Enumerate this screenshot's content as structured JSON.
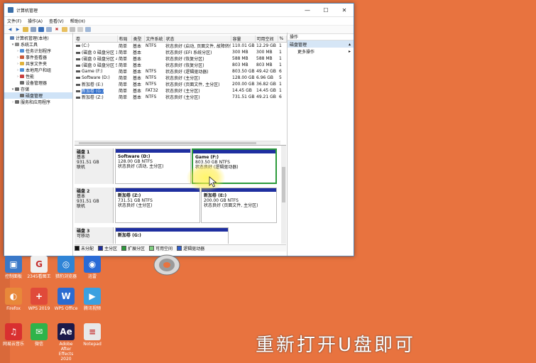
{
  "window": {
    "title": "计算机管理",
    "menu": [
      "文件(F)",
      "操作(A)",
      "查看(V)",
      "帮助(H)"
    ],
    "min_icon": "minimize-icon",
    "max_icon": "maximize-icon",
    "close_icon": "close-icon"
  },
  "tree": {
    "items": [
      {
        "label": "计算机管理(本地)",
        "indent": 0,
        "arrow": "",
        "color": "#5a7db0"
      },
      {
        "label": "系统工具",
        "indent": 1,
        "arrow": "▾",
        "color": "#8a8a8a"
      },
      {
        "label": "任务计划程序",
        "indent": 2,
        "arrow": "›",
        "color": "#4f8fd6"
      },
      {
        "label": "事件查看器",
        "indent": 2,
        "arrow": "›",
        "color": "#c85a3a"
      },
      {
        "label": "共享文件夹",
        "indent": 2,
        "arrow": "›",
        "color": "#e0b23c"
      },
      {
        "label": "本地用户和组",
        "indent": 2,
        "arrow": "›",
        "color": "#4f8fd6"
      },
      {
        "label": "性能",
        "indent": 2,
        "arrow": "›",
        "color": "#c84040"
      },
      {
        "label": "设备管理器",
        "indent": 2,
        "arrow": "",
        "color": "#6a6a6a"
      },
      {
        "label": "存储",
        "indent": 1,
        "arrow": "▾",
        "color": "#6a6a6a"
      },
      {
        "label": "磁盘管理",
        "indent": 2,
        "arrow": "",
        "color": "#6a6a6a",
        "selected": true
      },
      {
        "label": "服务和应用程序",
        "indent": 1,
        "arrow": "›",
        "color": "#6a6a6a"
      }
    ]
  },
  "volumes": {
    "headers": [
      "卷",
      "布局",
      "类型",
      "文件系统",
      "状态",
      "容量",
      "可用空间",
      "%"
    ],
    "rows": [
      [
        "(C:)",
        "简单",
        "基本",
        "NTFS",
        "状态良好 (启动, 页面文件, 故障转储, 主分区)",
        "110.01 GB",
        "12.29 GB",
        "1"
      ],
      [
        "(磁盘 0 磁盘分区 1)",
        "简单",
        "基本",
        "",
        "状态良好 (EFI 系统分区)",
        "300 MB",
        "300 MB",
        "1"
      ],
      [
        "(磁盘 0 磁盘分区 4)",
        "简单",
        "基本",
        "",
        "状态良好 (恢复分区)",
        "588 MB",
        "588 MB",
        "1"
      ],
      [
        "(磁盘 0 磁盘分区 5)",
        "简单",
        "基本",
        "",
        "状态良好 (恢复分区)",
        "803 MB",
        "803 MB",
        "1"
      ],
      [
        "Game (F:)",
        "简单",
        "基本",
        "NTFS",
        "状态良好 (逻辑驱动器)",
        "803.50 GB",
        "49.42 GB",
        "6"
      ],
      [
        "Software (D:)",
        "简单",
        "基本",
        "NTFS",
        "状态良好 (主分区)",
        "128.00 GB",
        "6.96 GB",
        "5"
      ],
      [
        "新加卷 (E:)",
        "简单",
        "基本",
        "NTFS",
        "状态良好 (页面文件, 主分区)",
        "200.00 GB",
        "36.82 GB",
        "1"
      ],
      [
        "新加卷 (G:)",
        "简单",
        "基本",
        "FAT32",
        "状态良好 (主分区)",
        "14.45 GB",
        "14.45 GB",
        "1"
      ],
      [
        "新加卷 (Z:)",
        "简单",
        "基本",
        "NTFS",
        "状态良好 (主分区)",
        "731.51 GB",
        "49.21 GB",
        "6"
      ]
    ],
    "selected_index": 7
  },
  "disks": [
    {
      "name": "磁盘 1",
      "type": "基本",
      "size": "931.51 GB",
      "status": "联机",
      "partitions": [
        {
          "name": "Software (D:)",
          "size": "128.00 GB NTFS",
          "status": "状态良好 (活动, 主分区)"
        },
        {
          "name": "Game (F:)",
          "size": "803.50 GB NTFS",
          "status": "状态良好 (逻辑驱动器)",
          "highlight": true
        }
      ]
    },
    {
      "name": "磁盘 2",
      "type": "基本",
      "size": "931.51 GB",
      "status": "联机",
      "partitions": [
        {
          "name": "新加卷 (Z:)",
          "size": "731.51 GB NTFS",
          "status": "状态良好 (主分区)"
        },
        {
          "name": "新加卷 (E:)",
          "size": "200.00 GB NTFS",
          "status": "状态良好 (页面文件, 主分区)"
        }
      ]
    },
    {
      "name": "磁盘 3",
      "type": "可移动",
      "size": "",
      "status": "",
      "partitions": [
        {
          "name": "新加卷 (G:)",
          "size": "",
          "status": ""
        }
      ]
    }
  ],
  "legend": [
    {
      "label": "未分配",
      "color": "#111111"
    },
    {
      "label": "主分区",
      "color": "#1f2fa0"
    },
    {
      "label": "扩展分区",
      "color": "#2b9a3a"
    },
    {
      "label": "可用空间",
      "color": "#7fd07f"
    },
    {
      "label": "逻辑驱动器",
      "color": "#2f5fd0"
    }
  ],
  "actions": {
    "header": "操作",
    "items": [
      {
        "label": "磁盘管理",
        "selected": true,
        "arrow": "▴"
      },
      {
        "label": "更多操作",
        "selected": false,
        "arrow": "▸"
      }
    ]
  },
  "desktop": {
    "icons": [
      {
        "label": "控制面板",
        "color": "#3a78c8",
        "glyph": "▣"
      },
      {
        "label": "2345看图王",
        "color": "#f0f0f0",
        "glyph": "G"
      },
      {
        "label": "猎豹浏览器",
        "color": "#2f84d6",
        "glyph": "◎"
      },
      {
        "label": "迅雷",
        "color": "#2a6bd6",
        "glyph": "◉"
      },
      {
        "label": "Firefox",
        "color": "#e8883a",
        "glyph": "◐"
      },
      {
        "label": "WPS 2019",
        "color": "#e04a3a",
        "glyph": "+"
      },
      {
        "label": "WPS Office",
        "color": "#2c6bd0",
        "glyph": "W"
      },
      {
        "label": "腾讯视频",
        "color": "#3aa0e0",
        "glyph": "▶"
      },
      {
        "label": "网易云音乐",
        "color": "#d93030",
        "glyph": "♫"
      },
      {
        "label": "微信",
        "color": "#2fb34a",
        "glyph": "✉"
      },
      {
        "label": "Adobe After Effects 2020",
        "color": "#1b1a4a",
        "glyph": "Ae"
      },
      {
        "label": "Notepad",
        "color": "#e8e8e8",
        "glyph": "≡"
      }
    ]
  },
  "caption": "重新打开U盘即可"
}
